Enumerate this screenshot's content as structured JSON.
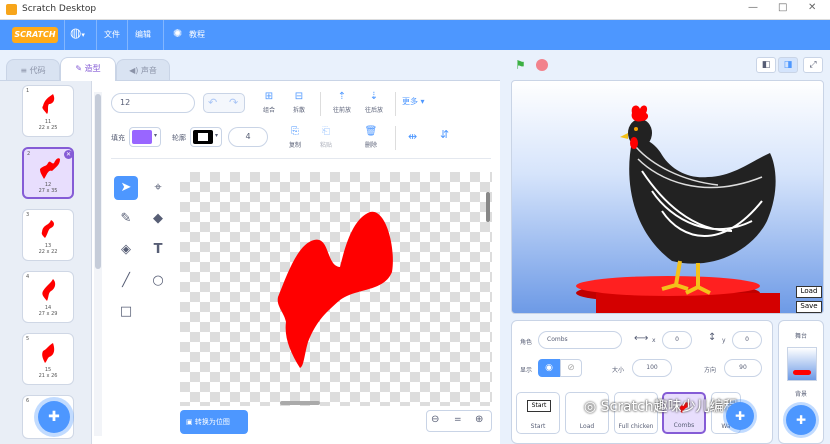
{
  "window": {
    "title": "Scratch Desktop",
    "min": "—",
    "max": "□",
    "close": "✕"
  },
  "menu": {
    "logo": "SCRATCH",
    "file": "文件",
    "edit": "编辑",
    "tutorials": "教程"
  },
  "tabs": {
    "code": "代码",
    "costumes": "造型",
    "sounds": "声音"
  },
  "costumes": [
    {
      "num": "1",
      "name": "11",
      "size": "22 x 25"
    },
    {
      "num": "2",
      "name": "12",
      "size": "27 x 35"
    },
    {
      "num": "3",
      "name": "13",
      "size": "22 x 22"
    },
    {
      "num": "4",
      "name": "14",
      "size": "27 x 29"
    },
    {
      "num": "5",
      "name": "15",
      "size": "21 x 26"
    },
    {
      "num": "6",
      "name": "",
      "size": ""
    }
  ],
  "editor": {
    "costume_name": "12",
    "group": "组合",
    "ungroup": "拆散",
    "forward": "往前放",
    "backward": "往后放",
    "more": "更多",
    "fill_label": "填充",
    "outline_label": "轮廓",
    "outline_width": "4",
    "copy": "复制",
    "paste": "粘贴",
    "delete": "删除",
    "convert": "转换为位图",
    "zoom_reset": "="
  },
  "stage_buttons": {
    "load": "Load",
    "save": "Save"
  },
  "sprite": {
    "label_sprite": "角色",
    "name": "Combs",
    "x_label": "x",
    "x": "0",
    "y_label": "y",
    "y": "0",
    "show_label": "显示",
    "size_label": "大小",
    "size": "100",
    "direction_label": "方向",
    "direction": "90"
  },
  "sprites": [
    {
      "name": "Start",
      "thumb": "Start"
    },
    {
      "name": "Load"
    },
    {
      "name": "Full chicken"
    },
    {
      "name": "Combs"
    },
    {
      "name": "Wa"
    }
  ],
  "stage_panel": {
    "title": "舞台",
    "backdrops": "背景"
  },
  "watermark": "Scratch趣味少儿编程",
  "colors": {
    "menu": "#4d97ff",
    "accent": "#855cd6",
    "fill": "#9966ff",
    "comb": "#ff0000"
  }
}
